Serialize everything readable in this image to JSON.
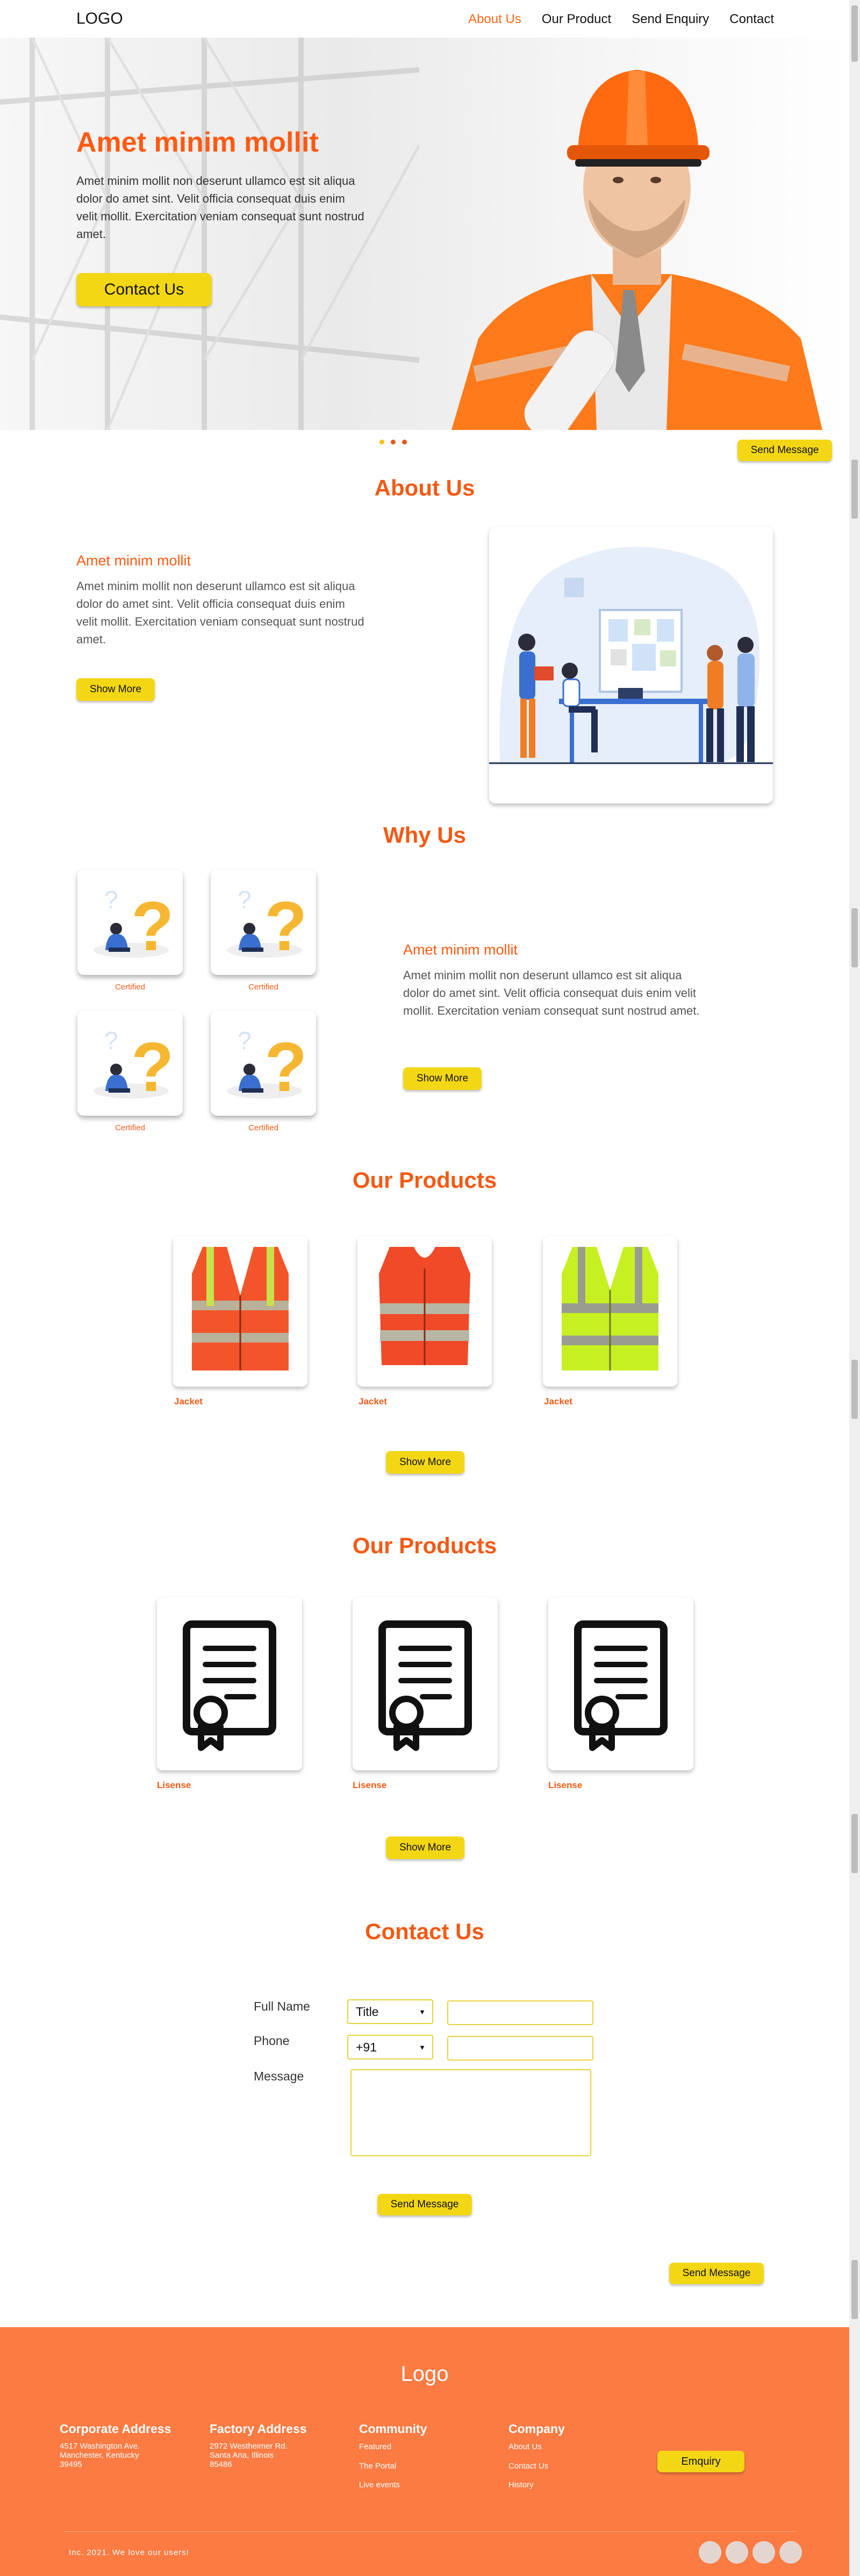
{
  "header": {
    "logo": "LOGO",
    "nav": [
      "About Us",
      "Our Product",
      "Send Enquiry",
      "Contact"
    ]
  },
  "hero": {
    "title": "Amet minim mollit",
    "text": "Amet minim mollit non deserunt ullamco est sit aliqua dolor do amet sint. Velit officia consequat duis enim velit mollit. Exercitation veniam consequat sunt nostrud amet.",
    "button": "Contact Us",
    "send_button": "Send Message"
  },
  "about": {
    "title": "About  Us",
    "subtitle": "Amet minim mollit",
    "text": "Amet minim mollit non deserunt ullamco est sit aliqua dolor do amet sint. Velit officia consequat duis enim velit mollit. Exercitation veniam consequat sunt nostrud amet.",
    "button": "Show More"
  },
  "why": {
    "title": "Why  Us",
    "cards": [
      "Certified",
      "Certified",
      "Certified",
      "Certified"
    ],
    "subtitle": "Amet minim mollit",
    "text": "Amet minim mollit non deserunt ullamco est sit aliqua dolor do amet sint. Velit officia consequat duis enim velit mollit. Exercitation veniam consequat sunt nostrud amet.",
    "button": "Show More"
  },
  "products": {
    "title": "Our  Products",
    "items": [
      "Jacket",
      "Jacket",
      "Jacket"
    ],
    "button": "Show More"
  },
  "licenses": {
    "title": "Our  Products",
    "items": [
      "Lisense",
      "Lisense",
      "Lisense"
    ],
    "button": "Show More"
  },
  "contact": {
    "title": "Contact  Us",
    "full_name_label": "Full Name",
    "title_select": "Title",
    "phone_label": "Phone",
    "phone_code": "+91",
    "message_label": "Message",
    "send_button": "Send Message",
    "send_button_right": "Send Message"
  },
  "footer": {
    "logo": "Logo",
    "corporate": {
      "title": "Corporate Address",
      "lines": [
        "4517 Washington Ave.",
        "Manchester, Kentucky",
        "39495"
      ]
    },
    "factory": {
      "title": "Factory Address",
      "lines": [
        "2972 Westheimer Rd.",
        "Santa Ana, Illinois",
        "85486"
      ]
    },
    "community": {
      "title": "Community",
      "links": [
        "Featured",
        "The Portal",
        "Live events"
      ]
    },
    "company": {
      "title": "Company",
      "links": [
        "About Us",
        "Contact Us",
        "History"
      ]
    },
    "enquiry_button": "Emquiry",
    "copyright": "Inc. 2021. We love our users!"
  },
  "colors": {
    "accent": "#f25a14",
    "button": "#f3d715",
    "footer": "#fb7b43"
  }
}
